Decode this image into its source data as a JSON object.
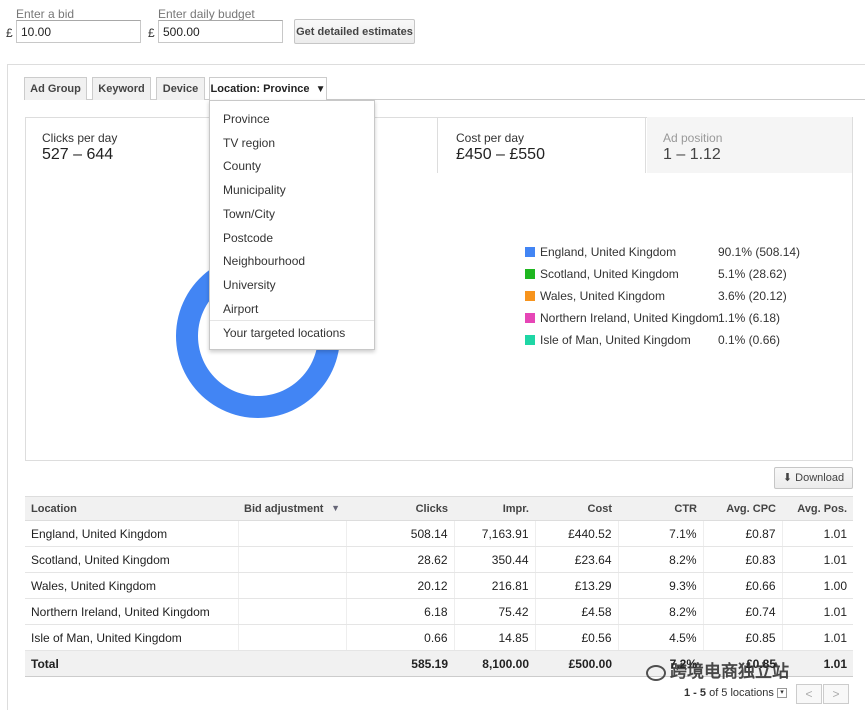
{
  "bid": {
    "label": "Enter a bid",
    "currency": "£",
    "value": "10.00"
  },
  "budget": {
    "label": "Enter daily budget",
    "currency": "£",
    "value": "500.00"
  },
  "estimate_button": "Get detailed estimates",
  "tabs": [
    {
      "label": "Ad Group"
    },
    {
      "label": "Keyword"
    },
    {
      "label": "Device"
    },
    {
      "label": "Location: Province",
      "caret": "▼"
    }
  ],
  "stats": [
    {
      "label": "Clicks per day",
      "value": "527 – 644"
    },
    {
      "label": "Cost per day",
      "value": "£450 – £550"
    },
    {
      "label": "Ad position",
      "value": "1 – 1.12"
    }
  ],
  "dropdown": {
    "items": [
      "Province",
      "TV region",
      "County",
      "Municipality",
      "Town/City",
      "Postcode",
      "Neighbourhood",
      "University",
      "Airport"
    ],
    "footer": "Your targeted locations"
  },
  "chart_data": {
    "type": "pie",
    "variant": "donut",
    "categories": [
      "England, United Kingdom",
      "Scotland, United Kingdom",
      "Wales, United Kingdom",
      "Northern Ireland, United Kingdom",
      "Isle of Man, United Kingdom"
    ],
    "values": [
      90.1,
      5.1,
      3.6,
      1.1,
      0.1
    ],
    "labels": [
      "90.1% (508.14)",
      "5.1% (28.62)",
      "3.6% (20.12)",
      "1.1% (6.18)",
      "0.1% (0.66)"
    ],
    "colors": [
      "#4285f4",
      "#1fb720",
      "#f7941d",
      "#e646b6",
      "#1ed6a5"
    ],
    "legend": "right"
  },
  "download_label": "Download",
  "table": {
    "headers": [
      "Location",
      "Bid adjustment",
      "Clicks",
      "Impr.",
      "Cost",
      "CTR",
      "Avg. CPC",
      "Avg. Pos."
    ],
    "rows": [
      [
        "England, United Kingdom",
        "",
        "508.14",
        "7,163.91",
        "£440.52",
        "7.1%",
        "£0.87",
        "1.01"
      ],
      [
        "Scotland, United Kingdom",
        "",
        "28.62",
        "350.44",
        "£23.64",
        "8.2%",
        "£0.83",
        "1.01"
      ],
      [
        "Wales, United Kingdom",
        "",
        "20.12",
        "216.81",
        "£13.29",
        "9.3%",
        "£0.66",
        "1.00"
      ],
      [
        "Northern Ireland, United Kingdom",
        "",
        "6.18",
        "75.42",
        "£4.58",
        "8.2%",
        "£0.74",
        "1.01"
      ],
      [
        "Isle of Man, United Kingdom",
        "",
        "0.66",
        "14.85",
        "£0.56",
        "4.5%",
        "£0.85",
        "1.01"
      ]
    ],
    "total": [
      "Total",
      "",
      "585.19",
      "8,100.00",
      "£500.00",
      "7.2%",
      "£0.85",
      "1.01"
    ]
  },
  "pager": {
    "range": "1 - 5",
    "of_text": "of 5 locations",
    "prev": "<",
    "next": ">"
  },
  "watermark": "跨境电商独立站"
}
